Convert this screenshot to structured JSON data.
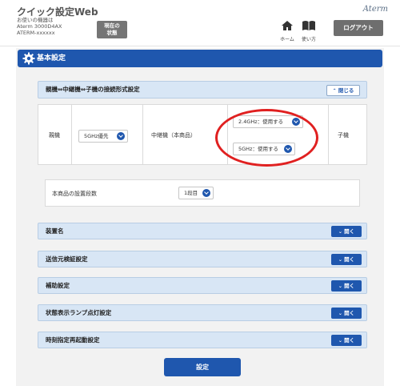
{
  "header": {
    "app_title": "クイック設定Web",
    "device_label": "お使いの機器は",
    "device_model": "Aterm 3000D4AX",
    "device_id": "ATERM-xxxxxx",
    "status_button": "現在の\n状態",
    "brand": "Aterm",
    "home_label": "ホーム",
    "help_label": "使い方",
    "logout_label": "ログアウト"
  },
  "page": {
    "title": "基本設定"
  },
  "connection": {
    "header": "親機⇔中継機⇔子機の接続形式設定",
    "close_label": "閉じる",
    "parent_label": "親機",
    "parent_value": "5GHz優先",
    "repeater_label": "中継機（本商品）",
    "band24_value": "2.4GHz：使用する",
    "band5_value": "5GHz：使用する",
    "child_label": "子機"
  },
  "install": {
    "label": "本商品の設置段数",
    "value": "1段目"
  },
  "sections": [
    {
      "label": "装置名",
      "button": "開く"
    },
    {
      "label": "送信元検証設定",
      "button": "開く"
    },
    {
      "label": "補助設定",
      "button": "開く"
    },
    {
      "label": "状態表示ランプ点灯設定",
      "button": "開く"
    },
    {
      "label": "時刻指定再起動設定",
      "button": "開く"
    }
  ],
  "submit_label": "設定",
  "colors": {
    "accent": "#1f57ae",
    "section_bg": "#d8e6f5",
    "highlight": "#e02020"
  }
}
